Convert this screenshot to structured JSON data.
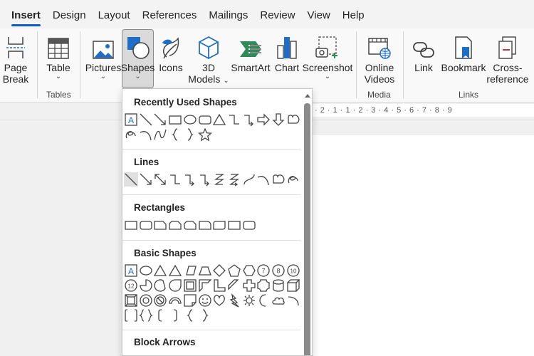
{
  "tabs": [
    "Insert",
    "Design",
    "Layout",
    "References",
    "Mailings",
    "Review",
    "View",
    "Help"
  ],
  "active_tab": "Insert",
  "ribbon": {
    "page_break": [
      "Page",
      "Break"
    ],
    "table": "Table",
    "pictures": "Pictures",
    "shapes": "Shapes",
    "icons": "Icons",
    "models": [
      "3D",
      "Models"
    ],
    "smartart": "SmartArt",
    "chart": "Chart",
    "screenshot": "Screenshot",
    "online_videos": [
      "Online",
      "Videos"
    ],
    "link": "Link",
    "bookmark": "Bookmark",
    "cross_reference": [
      "Cross-",
      "reference"
    ],
    "groups": {
      "tables": "Tables",
      "media": "Media",
      "links": "Links"
    }
  },
  "ruler_text": "· 2 · 1 · 1 · 2 · 3 · 4 · 5 · 6 · 7 · 8 · 9",
  "shapes_menu": {
    "sections": [
      {
        "title": "Recently Used Shapes"
      },
      {
        "title": "Lines"
      },
      {
        "title": "Rectangles"
      },
      {
        "title": "Basic Shapes"
      },
      {
        "title": "Block Arrows"
      }
    ],
    "octagon_label": "8",
    "decagon_label": "10",
    "dodecagon_label": "12",
    "heptagon_label": "7",
    "textbox_glyph": "A"
  },
  "colors": {
    "accent": "#0f5ec7",
    "selected_bg": "#dadada",
    "icon_blue": "#1e6ec8",
    "icon_green": "#2e8b57",
    "icon_red": "#c8323c"
  }
}
